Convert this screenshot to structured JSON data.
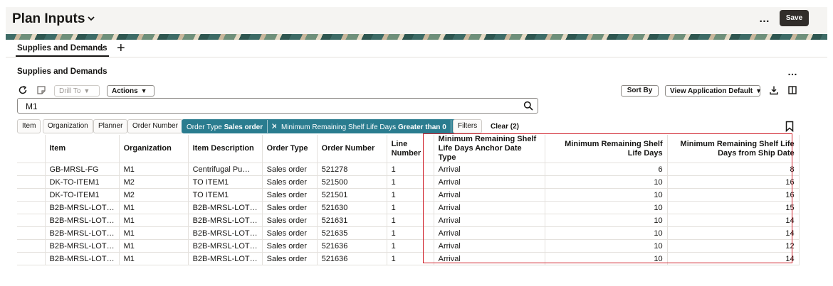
{
  "header": {
    "title": "Plan Inputs",
    "more": "…",
    "save_label": "Save"
  },
  "tabs": [
    {
      "label": "Supplies and Demands",
      "close": "×"
    }
  ],
  "tab_add": "+",
  "section": {
    "title": "Supplies and Demands",
    "more": "…"
  },
  "toolbar": {
    "drill_to": "Drill To",
    "actions": "Actions",
    "sort_by": "Sort By",
    "view": "View Application Default"
  },
  "search": {
    "value": "M1"
  },
  "filters": {
    "chips": [
      "Item",
      "Organization",
      "Planner",
      "Order Number"
    ],
    "selected": [
      {
        "label": "Order Type",
        "value": "Sales order"
      },
      {
        "label": "Minimum Remaining Shelf Life Days",
        "value": "Greater than 0"
      }
    ],
    "filters_button": "Filters",
    "clear": "Clear (2)"
  },
  "table": {
    "columns": [
      "Item",
      "Organization",
      "Item Description",
      "Order Type",
      "Order Number",
      "Line Number",
      "Minimum Remaining Shelf Life Days Anchor Date Type",
      "Minimum Remaining Shelf Life Days",
      "Minimum Remaining Shelf Life Days from Ship Date"
    ],
    "rows": [
      [
        "GB-MRSL-FG",
        "M1",
        "Centrifugal Pu…",
        "Sales order",
        "521278",
        "1",
        "Arrival",
        "6",
        "8"
      ],
      [
        "DK-TO-ITEM1",
        "M2",
        "TO ITEM1",
        "Sales order",
        "521500",
        "1",
        "Arrival",
        "10",
        "16"
      ],
      [
        "DK-TO-ITEM1",
        "M2",
        "TO ITEM1",
        "Sales order",
        "521501",
        "1",
        "Arrival",
        "10",
        "16"
      ],
      [
        "B2B-MRSL-LOT…",
        "M1",
        "B2B-MRSL-LOT…",
        "Sales order",
        "521630",
        "1",
        "Arrival",
        "10",
        "15"
      ],
      [
        "B2B-MRSL-LOT…",
        "M1",
        "B2B-MRSL-LOT…",
        "Sales order",
        "521631",
        "1",
        "Arrival",
        "10",
        "14"
      ],
      [
        "B2B-MRSL-LOT…",
        "M1",
        "B2B-MRSL-LOT…",
        "Sales order",
        "521635",
        "1",
        "Arrival",
        "10",
        "14"
      ],
      [
        "B2B-MRSL-LOT…",
        "M1",
        "B2B-MRSL-LOT…",
        "Sales order",
        "521636",
        "1",
        "Arrival",
        "10",
        "12"
      ],
      [
        "B2B-MRSL-LOT…",
        "M1",
        "B2B-MRSL-LOT…",
        "Sales order",
        "521636",
        "1",
        "Arrival",
        "10",
        "14"
      ]
    ]
  },
  "colors": {
    "chip_selected": "#2a7c8f",
    "save_button": "#312d2a",
    "highlight": "#d0202a"
  }
}
